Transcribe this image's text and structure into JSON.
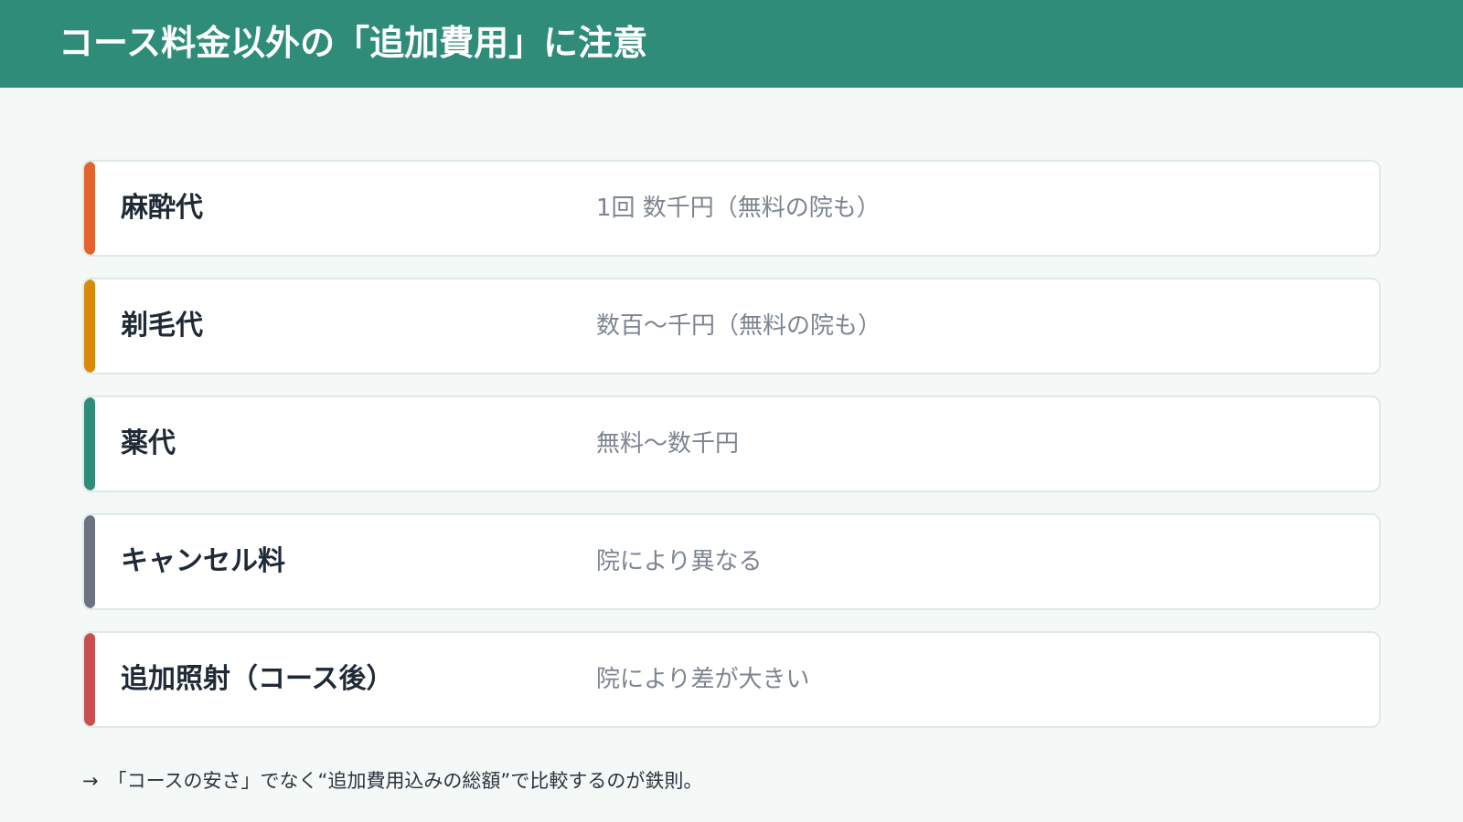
{
  "header": {
    "title": "コース料金以外の「追加費用」に注意",
    "background": "#2e8c79"
  },
  "items": [
    {
      "label": "麻酔代",
      "description": "1回 数千円（無料の院も）",
      "color": "#e3622d"
    },
    {
      "label": "剃毛代",
      "description": "数百〜千円（無料の院も）",
      "color": "#d98a0b"
    },
    {
      "label": "薬代",
      "description": "無料〜数千円",
      "color": "#2e8c79"
    },
    {
      "label": "キャンセル料",
      "description": "院により異なる",
      "color": "#6b7280"
    },
    {
      "label": "追加照射（コース後）",
      "description": "院により差が大きい",
      "color": "#c94f4f"
    }
  ],
  "footnote": {
    "arrow": "→",
    "text": "「コースの安さ」でなく“追加費用込みの総額”で比較するのが鉄則。"
  }
}
